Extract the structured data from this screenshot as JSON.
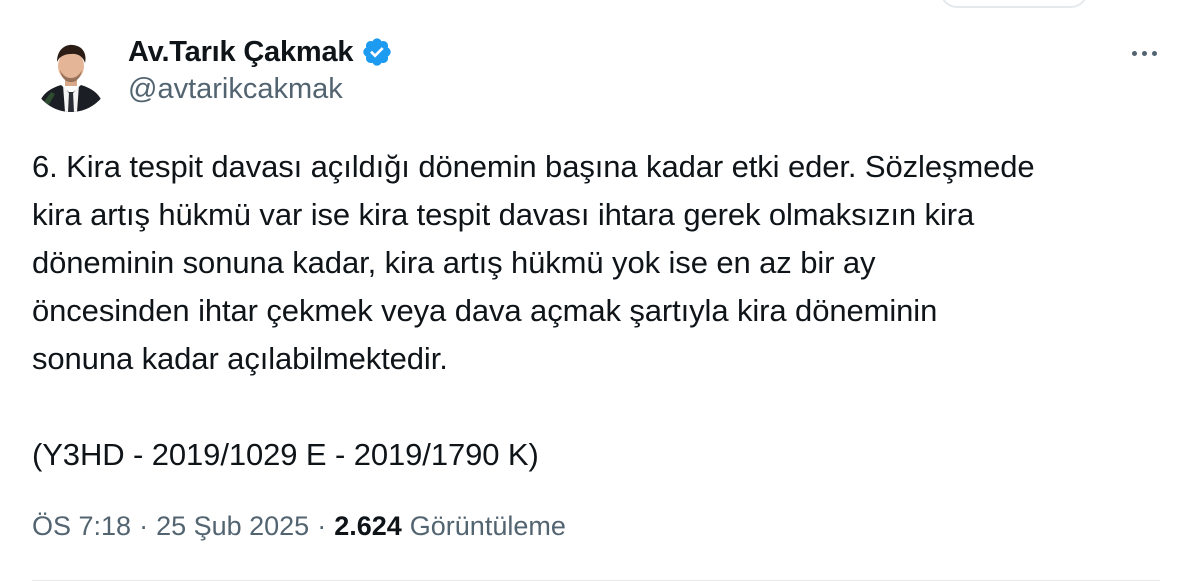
{
  "author": {
    "display_name": "Av.Tarık Çakmak",
    "handle": "@avtarikcakmak",
    "verified": true,
    "verified_badge_color": "#1d9bf0",
    "avatar_icon": "person-in-suit-icon"
  },
  "actions": {
    "more_icon": "more-horizontal-icon"
  },
  "tweet": {
    "lines": [
      "6. Kira tespit davası açıldığı dönemin başına kadar etki eder. Sözleşmede",
      "kira artış hükmü var ise kira tespit davası ihtara gerek olmaksızın kira",
      "döneminin sonuna kadar, kira artış hükmü yok ise en az bir ay",
      "öncesinden ihtar çekmek veya dava açmak şartıyla kira döneminin",
      "sonuna kadar açılabilmektedir.",
      "",
      "(Y3HD - 2019/1029 E - 2019/1790 K)"
    ]
  },
  "meta": {
    "time": "ÖS 7:18",
    "separator": "·",
    "date": "25 Şub 2025",
    "views_count": "2.624",
    "views_label": "Görüntüleme"
  },
  "colors": {
    "text_primary": "#0f1419",
    "text_secondary": "#536471",
    "divider": "#e7eaed"
  }
}
